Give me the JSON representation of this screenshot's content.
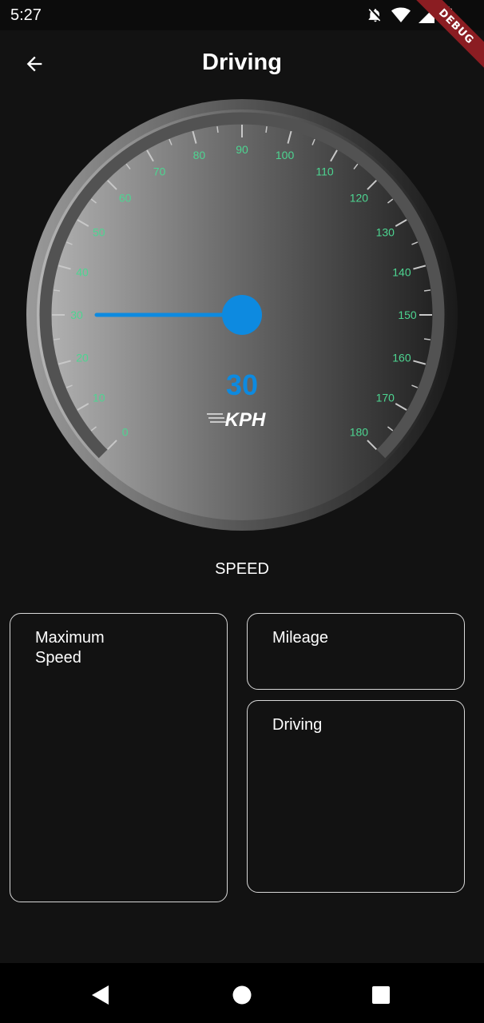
{
  "status_bar": {
    "time": "5:27",
    "icons": [
      "notifications-off-icon",
      "wifi-icon",
      "signal-icon",
      "battery-icon"
    ]
  },
  "debug_banner": "DEBUG",
  "app_bar": {
    "title": "Driving",
    "back_icon": "arrow-back-icon"
  },
  "gauge": {
    "min": 0,
    "max": 180,
    "label_step": 10,
    "tick_labels": [
      "0",
      "10",
      "20",
      "30",
      "40",
      "50",
      "60",
      "70",
      "80",
      "90",
      "100",
      "110",
      "120",
      "130",
      "140",
      "150",
      "160",
      "170",
      "180"
    ],
    "value": 30,
    "value_text": "30",
    "unit": "KPH",
    "colors": {
      "tick_label": "#4dd591",
      "needle": "#0d8ae0",
      "value": "#0d8ae0"
    }
  },
  "speed_caption": "SPEED",
  "cards": {
    "max_speed": {
      "title": "Maximum\nSpeed"
    },
    "mileage": {
      "title": "Mileage"
    },
    "driving": {
      "title": "Driving"
    }
  },
  "nav_bar": {
    "icons": [
      "back-triangle-icon",
      "home-circle-icon",
      "recents-square-icon"
    ]
  }
}
